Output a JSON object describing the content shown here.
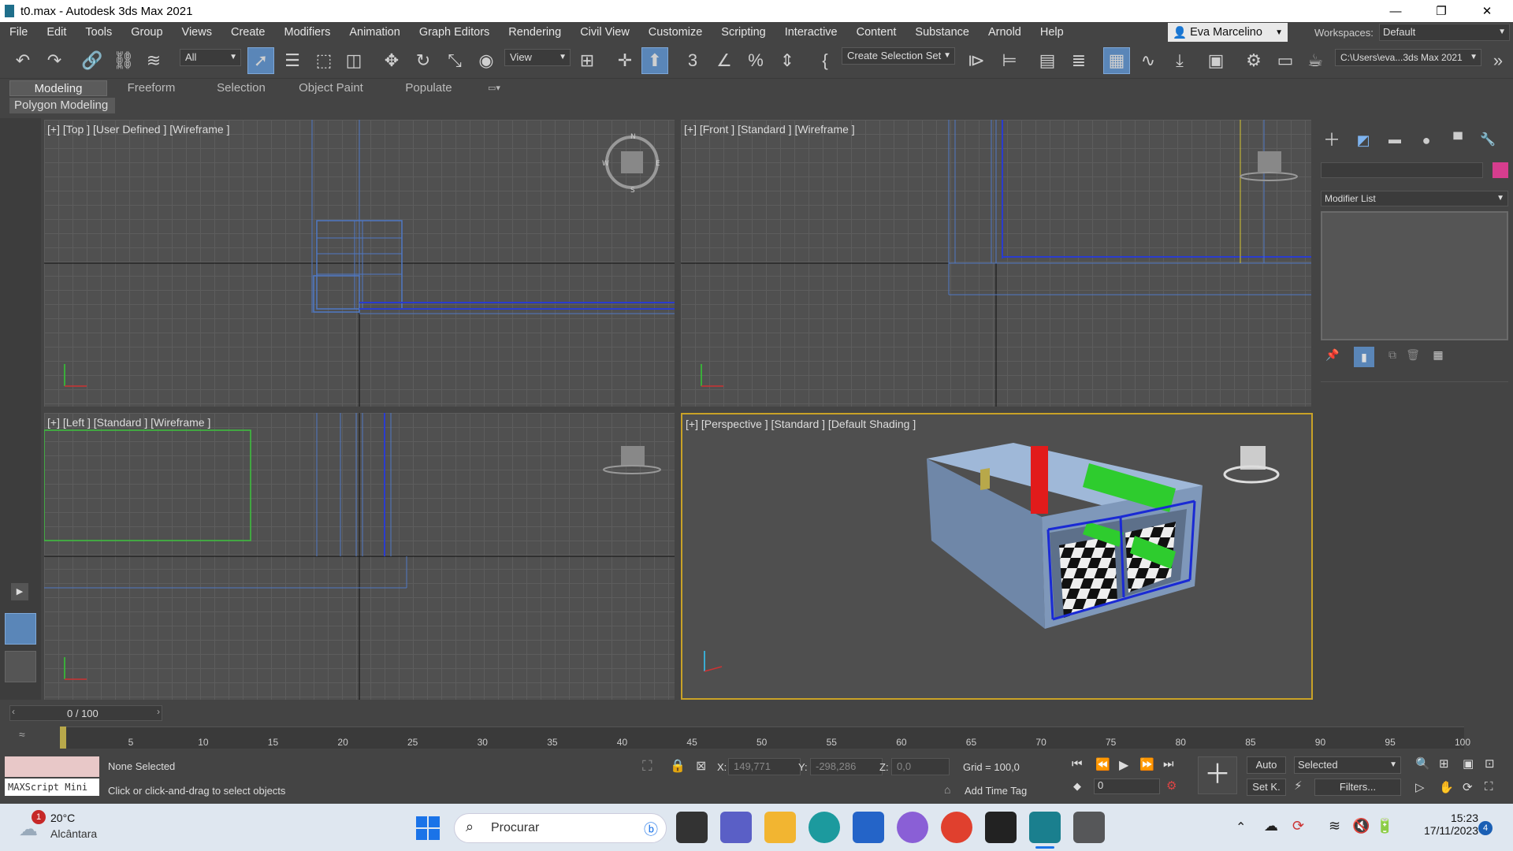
{
  "window": {
    "title": "t0.max - Autodesk 3ds Max 2021",
    "minimize": "—",
    "restore": "❐",
    "close": "✕"
  },
  "menu": [
    "File",
    "Edit",
    "Tools",
    "Group",
    "Views",
    "Create",
    "Modifiers",
    "Animation",
    "Graph Editors",
    "Rendering",
    "Civil View",
    "Customize",
    "Scripting",
    "Interactive",
    "Content",
    "Substance",
    "Arnold",
    "Help"
  ],
  "user": {
    "name": "Eva Marcelino"
  },
  "workspace": {
    "label": "Workspaces:",
    "value": "Default"
  },
  "toolbar": {
    "filter_value": "All",
    "ref_coord_value": "View",
    "selection_set": "Create Selection Set",
    "path": "C:\\Users\\eva...3ds Max 2021"
  },
  "ribbon": {
    "tabs": [
      "Modeling",
      "Freeform",
      "Selection",
      "Object Paint",
      "Populate"
    ],
    "sub": "Polygon Modeling"
  },
  "viewports": {
    "top": "[+] [Top ] [User Defined ] [Wireframe ]",
    "front": "[+] [Front ] [Standard ] [Wireframe ]",
    "left": "[+] [Left ] [Standard ] [Wireframe ]",
    "persp": "[+] [Perspective ] [Standard ] [Default Shading ]"
  },
  "command_panel": {
    "modifier_list": "Modifier List"
  },
  "timeline": {
    "frame_display": "0 / 100",
    "ticks": [
      "5",
      "10",
      "15",
      "20",
      "25",
      "30",
      "35",
      "40",
      "45",
      "50",
      "55",
      "60",
      "65",
      "70",
      "75",
      "80",
      "85",
      "90",
      "95",
      "100"
    ]
  },
  "status": {
    "maxscript": "MAXScript Mini",
    "selection": "None Selected",
    "prompt": "Click or click-and-drag to select objects",
    "x_label": "X:",
    "x_value": "149,771",
    "y_label": "Y:",
    "y_value": "-298,286",
    "z_label": "Z:",
    "z_value": "0,0",
    "grid": "Grid = 100,0",
    "add_time_tag": "Add Time Tag",
    "auto": "Auto",
    "setkey": "Set K.",
    "selected": "Selected",
    "frame_value": "0",
    "filters": "Filters..."
  },
  "taskbar": {
    "weather_temp": "20°C",
    "weather_loc": "Alcântara",
    "weather_badge": "1",
    "search": "Procurar",
    "time": "15:23",
    "date": "17/11/2023",
    "notif": "4"
  }
}
